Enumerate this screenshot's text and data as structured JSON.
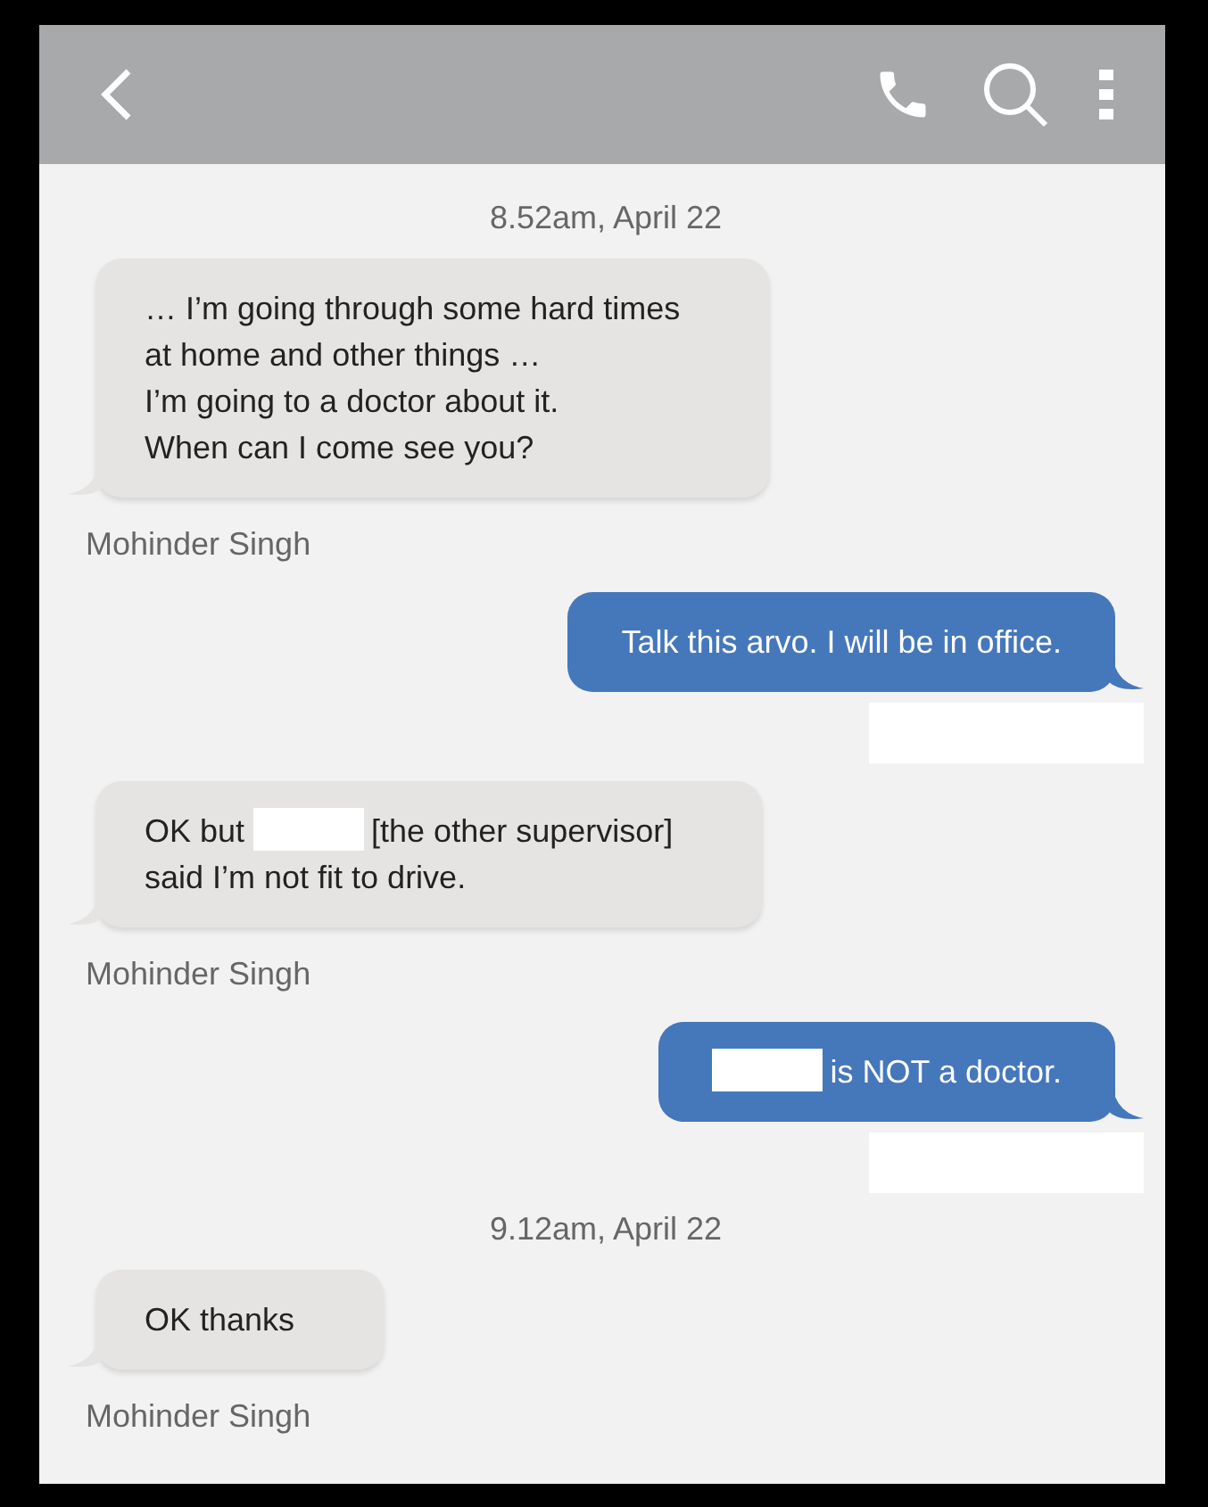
{
  "messages": [
    {
      "kind": "timestamp",
      "text": "8.52am, April 22"
    },
    {
      "kind": "message",
      "outgoing": false,
      "parts": [
        {
          "kind": "text",
          "text": "… I’m going through some hard times\nat home and other things …\nI’m going to a doctor about it.\nWhen can I come see you?"
        }
      ],
      "sender": "Mohinder Singh"
    },
    {
      "kind": "message",
      "outgoing": true,
      "parts": [
        {
          "kind": "text",
          "text": "Talk this arvo. I will be in office."
        }
      ],
      "sender_redacted": true
    },
    {
      "kind": "message",
      "outgoing": false,
      "parts": [
        {
          "kind": "text",
          "text": "OK but "
        },
        {
          "kind": "redaction"
        },
        {
          "kind": "text",
          "text": "[the other supervisor]"
        },
        {
          "kind": "break"
        },
        {
          "kind": "text",
          "text": "said I’m not fit to drive."
        }
      ],
      "sender": "Mohinder Singh"
    },
    {
      "kind": "message",
      "outgoing": true,
      "parts": [
        {
          "kind": "redaction"
        },
        {
          "kind": "text",
          "text": "is NOT a doctor."
        }
      ],
      "sender_redacted": true
    },
    {
      "kind": "timestamp",
      "text": "9.12am, April 22"
    },
    {
      "kind": "message",
      "outgoing": false,
      "parts": [
        {
          "kind": "text",
          "text": "OK thanks"
        }
      ],
      "sender": "Mohinder Singh"
    }
  ]
}
